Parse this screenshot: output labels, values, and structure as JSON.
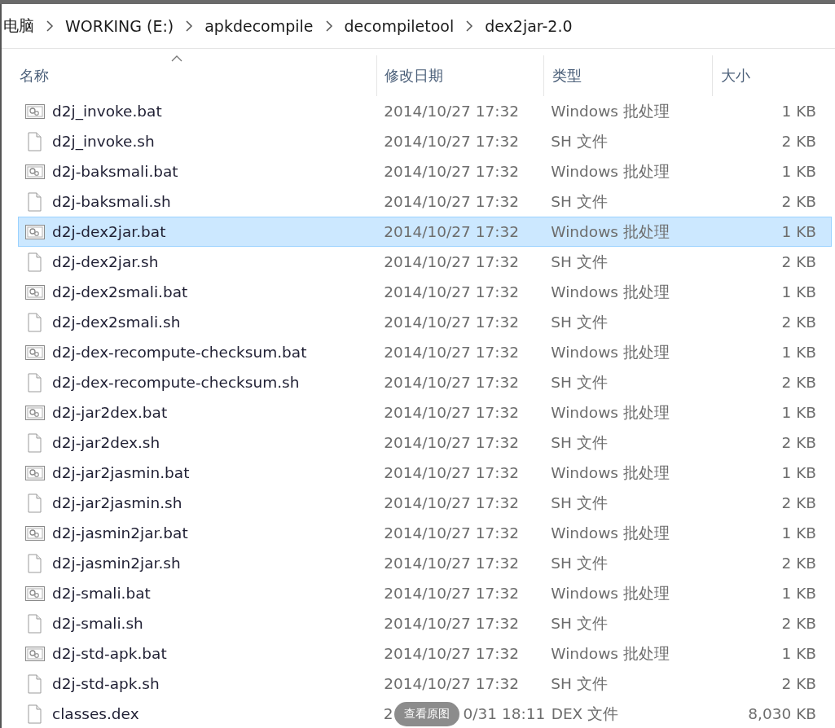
{
  "breadcrumb": [
    "电脑",
    "WORKING (E:)",
    "apkdecompile",
    "decompiletool",
    "dex2jar-2.0"
  ],
  "columns": [
    {
      "label": "名称",
      "sorted": true
    },
    {
      "label": "修改日期",
      "sorted": false
    },
    {
      "label": "类型",
      "sorted": false
    },
    {
      "label": "大小",
      "sorted": false
    }
  ],
  "files": [
    {
      "name": "d2j_invoke.bat",
      "kind": "batch",
      "date": "2014/10/27 17:32",
      "type": "Windows 批处理",
      "size": "1 KB",
      "selected": false
    },
    {
      "name": "d2j_invoke.sh",
      "kind": "file",
      "date": "2014/10/27 17:32",
      "type": "SH 文件",
      "size": "2 KB",
      "selected": false
    },
    {
      "name": "d2j-baksmali.bat",
      "kind": "batch",
      "date": "2014/10/27 17:32",
      "type": "Windows 批处理",
      "size": "1 KB",
      "selected": false
    },
    {
      "name": "d2j-baksmali.sh",
      "kind": "file",
      "date": "2014/10/27 17:32",
      "type": "SH 文件",
      "size": "2 KB",
      "selected": false
    },
    {
      "name": "d2j-dex2jar.bat",
      "kind": "batch",
      "date": "2014/10/27 17:32",
      "type": "Windows 批处理",
      "size": "1 KB",
      "selected": true
    },
    {
      "name": "d2j-dex2jar.sh",
      "kind": "file",
      "date": "2014/10/27 17:32",
      "type": "SH 文件",
      "size": "2 KB",
      "selected": false
    },
    {
      "name": "d2j-dex2smali.bat",
      "kind": "batch",
      "date": "2014/10/27 17:32",
      "type": "Windows 批处理",
      "size": "1 KB",
      "selected": false
    },
    {
      "name": "d2j-dex2smali.sh",
      "kind": "file",
      "date": "2014/10/27 17:32",
      "type": "SH 文件",
      "size": "2 KB",
      "selected": false
    },
    {
      "name": "d2j-dex-recompute-checksum.bat",
      "kind": "batch",
      "date": "2014/10/27 17:32",
      "type": "Windows 批处理",
      "size": "1 KB",
      "selected": false
    },
    {
      "name": "d2j-dex-recompute-checksum.sh",
      "kind": "file",
      "date": "2014/10/27 17:32",
      "type": "SH 文件",
      "size": "2 KB",
      "selected": false
    },
    {
      "name": "d2j-jar2dex.bat",
      "kind": "batch",
      "date": "2014/10/27 17:32",
      "type": "Windows 批处理",
      "size": "1 KB",
      "selected": false
    },
    {
      "name": "d2j-jar2dex.sh",
      "kind": "file",
      "date": "2014/10/27 17:32",
      "type": "SH 文件",
      "size": "2 KB",
      "selected": false
    },
    {
      "name": "d2j-jar2jasmin.bat",
      "kind": "batch",
      "date": "2014/10/27 17:32",
      "type": "Windows 批处理",
      "size": "1 KB",
      "selected": false
    },
    {
      "name": "d2j-jar2jasmin.sh",
      "kind": "file",
      "date": "2014/10/27 17:32",
      "type": "SH 文件",
      "size": "2 KB",
      "selected": false
    },
    {
      "name": "d2j-jasmin2jar.bat",
      "kind": "batch",
      "date": "2014/10/27 17:32",
      "type": "Windows 批处理",
      "size": "1 KB",
      "selected": false
    },
    {
      "name": "d2j-jasmin2jar.sh",
      "kind": "file",
      "date": "2014/10/27 17:32",
      "type": "SH 文件",
      "size": "2 KB",
      "selected": false
    },
    {
      "name": "d2j-smali.bat",
      "kind": "batch",
      "date": "2014/10/27 17:32",
      "type": "Windows 批处理",
      "size": "1 KB",
      "selected": false
    },
    {
      "name": "d2j-smali.sh",
      "kind": "file",
      "date": "2014/10/27 17:32",
      "type": "SH 文件",
      "size": "2 KB",
      "selected": false
    },
    {
      "name": "d2j-std-apk.bat",
      "kind": "batch",
      "date": "2014/10/27 17:32",
      "type": "Windows 批处理",
      "size": "1 KB",
      "selected": false
    },
    {
      "name": "d2j-std-apk.sh",
      "kind": "file",
      "date": "2014/10/27 17:32",
      "type": "SH 文件",
      "size": "2 KB",
      "selected": false
    },
    {
      "name": "classes.dex",
      "kind": "file",
      "date_parts": [
        "2",
        "0/31 18:11"
      ],
      "overlay_button": "查看原图",
      "type": "DEX 文件",
      "size": "8,030 KB",
      "selected": false
    }
  ]
}
